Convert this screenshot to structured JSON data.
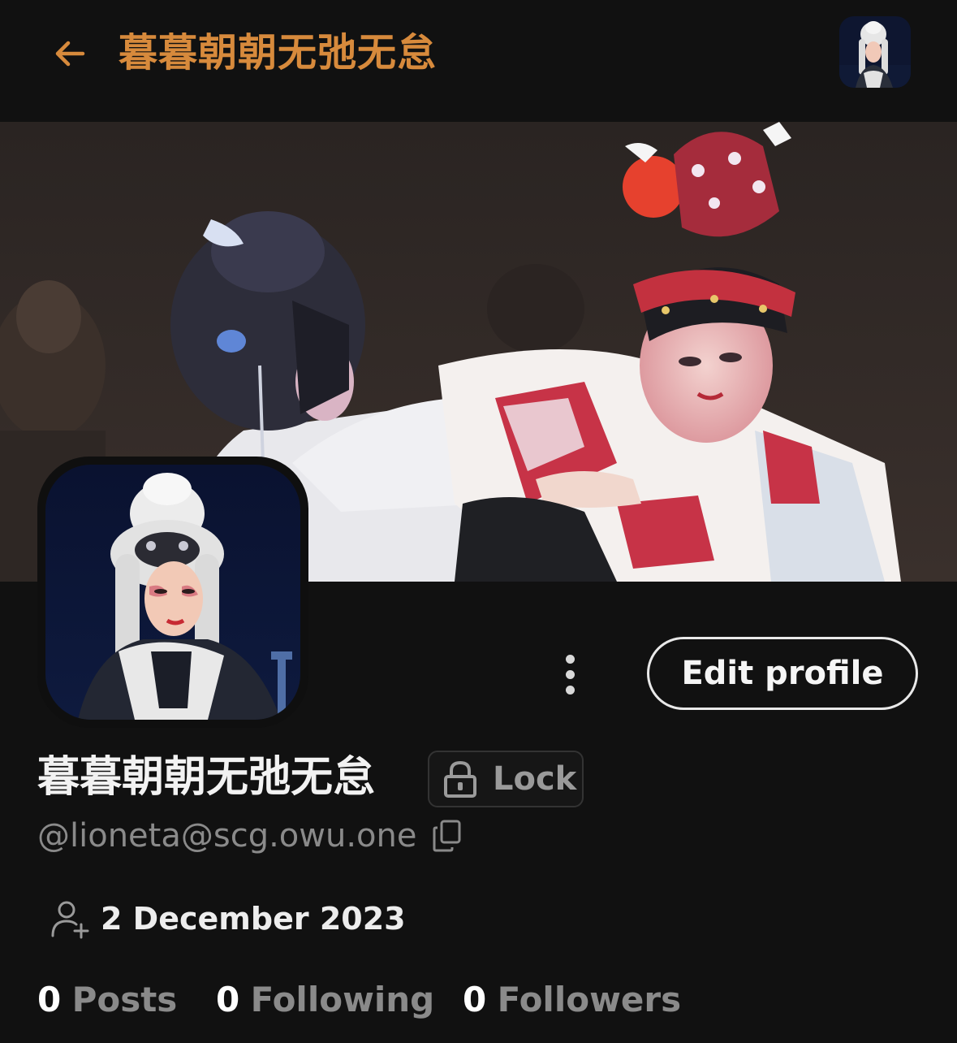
{
  "header": {
    "title": "暮暮朝朝无弛无怠"
  },
  "profile": {
    "display_name": "暮暮朝朝无弛无怠",
    "lock_label": "Lock",
    "handle": "@lioneta@scg.owu.one",
    "joined": "2 December 2023",
    "edit_label": "Edit profile"
  },
  "stats": [
    {
      "count": "0",
      "label": "Posts"
    },
    {
      "count": "0",
      "label": "Following"
    },
    {
      "count": "0",
      "label": "Followers"
    }
  ],
  "icons": {
    "back": "arrow-left-icon",
    "more": "more-vertical-icon",
    "lock": "lock-icon",
    "copy": "copy-icon",
    "joined": "user-plus-icon"
  },
  "colors": {
    "background": "#111111",
    "accent": "#d78a3c",
    "muted": "#8a8a8a"
  }
}
